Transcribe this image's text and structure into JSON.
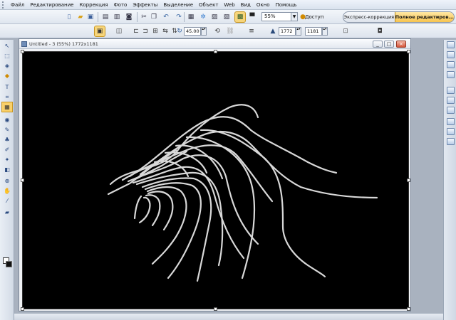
{
  "menu": [
    "Файл",
    "Редактирование",
    "Коррекция",
    "Фото",
    "Эффекты",
    "Выделение",
    "Объект",
    "Web",
    "Вид",
    "Окно",
    "Помощь"
  ],
  "toolbar": {
    "zoom_value": "55%",
    "access_label": "Доступ",
    "mode_express": "Экспресс-коррекция",
    "mode_full": "Полное редактиров..."
  },
  "options": {
    "rotate_angle": "45.00",
    "width": "1772",
    "height": "1181"
  },
  "document": {
    "title": "Untitled - 3 (55%) 1772x1181"
  },
  "colors": {
    "accent": "#f7c44f",
    "canvas": "#000000",
    "stroke": "#d8d8d8"
  }
}
